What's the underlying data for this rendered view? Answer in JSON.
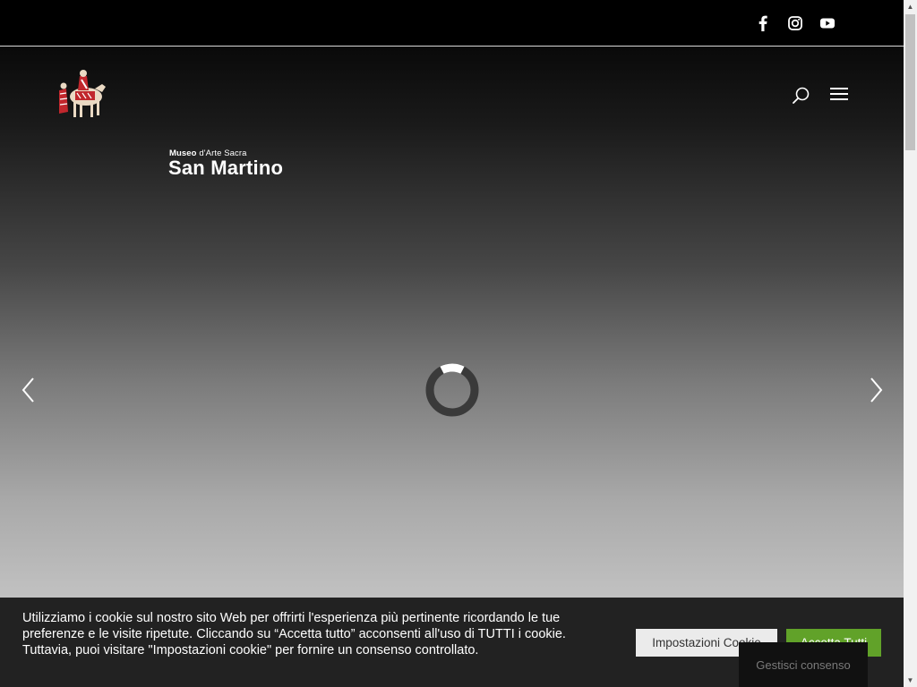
{
  "topbar": {
    "social": [
      {
        "name": "facebook-icon"
      },
      {
        "name": "instagram-icon"
      },
      {
        "name": "youtube-icon"
      }
    ]
  },
  "logo": {
    "line1_bold": "Museo",
    "line1_rest": " d'Arte Sacra",
    "line2": "San Martino"
  },
  "header": {
    "search_icon": "search-icon",
    "menu_icon": "hamburger-menu-icon"
  },
  "slider": {
    "prev_icon": "chevron-left-icon",
    "next_icon": "chevron-right-icon",
    "loading_icon": "loading-spinner-icon"
  },
  "cookie": {
    "text": "Utilizziamo i cookie sul nostro sito Web per offrirti l'esperienza più pertinente ricordando le tue preferenze e le visite ripetute. Cliccando su “Accetta tutto” acconsenti all'uso di TUTTI i cookie. Tuttavia, puoi visitare \"Impostazioni cookie\" per fornire un consenso controllato.",
    "settings_label": "Impostazioni Cookie",
    "accept_label": "Accetta Tutti",
    "manage_label": "Gestisci consenso"
  },
  "colors": {
    "accept_green": "#61a229",
    "cookie_bg": "#222222",
    "topbar_bg": "#000000"
  }
}
